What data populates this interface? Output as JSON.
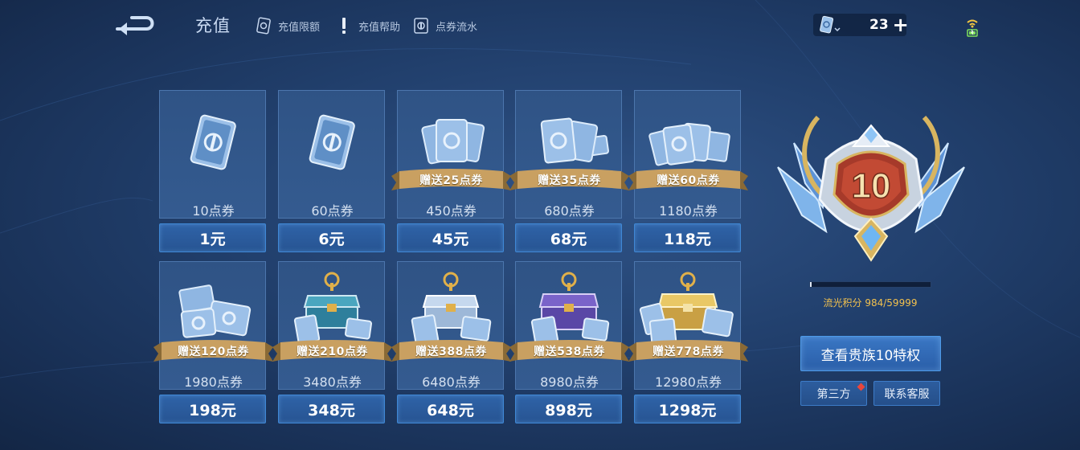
{
  "header": {
    "title": "充值",
    "links": [
      {
        "label": "充值限额",
        "icon": "card-limit-icon"
      },
      {
        "label": "充值帮助",
        "icon": "exclamation-icon"
      },
      {
        "label": "点券流水",
        "icon": "coupon-flow-icon"
      }
    ],
    "balance": {
      "amount": "23",
      "plus": "+",
      "icon": "coupon-icon"
    }
  },
  "items": [
    {
      "points": "10点券",
      "price": "1元",
      "bonus": ""
    },
    {
      "points": "60点券",
      "price": "6元",
      "bonus": ""
    },
    {
      "points": "450点券",
      "price": "45元",
      "bonus": "赠送25点券"
    },
    {
      "points": "680点券",
      "price": "68元",
      "bonus": "赠送35点券"
    },
    {
      "points": "1180点券",
      "price": "118元",
      "bonus": "赠送60点券"
    },
    {
      "points": "1980点券",
      "price": "198元",
      "bonus": "赠送120点券"
    },
    {
      "points": "3480点券",
      "price": "348元",
      "bonus": "赠送210点券"
    },
    {
      "points": "6480点券",
      "price": "648元",
      "bonus": "赠送388点券"
    },
    {
      "points": "8980点券",
      "price": "898元",
      "bonus": "赠送538点券"
    },
    {
      "points": "12980点券",
      "price": "1298元",
      "bonus": "赠送778点券"
    }
  ],
  "vip": {
    "level": "10",
    "points_label": "流光积分 984/59999",
    "progress": 0.0164,
    "privilege_button": "查看贵族10特权",
    "third_party_button": "第三方",
    "service_button": "联系客服"
  },
  "colors": {
    "background": "#213f6c",
    "card": "#345b90",
    "price_button": "#275492",
    "ribbon_gold": "#c9a061",
    "badge_red": "#a63a2a",
    "points_text": "#f2c14e",
    "notification": "#e8463c"
  }
}
